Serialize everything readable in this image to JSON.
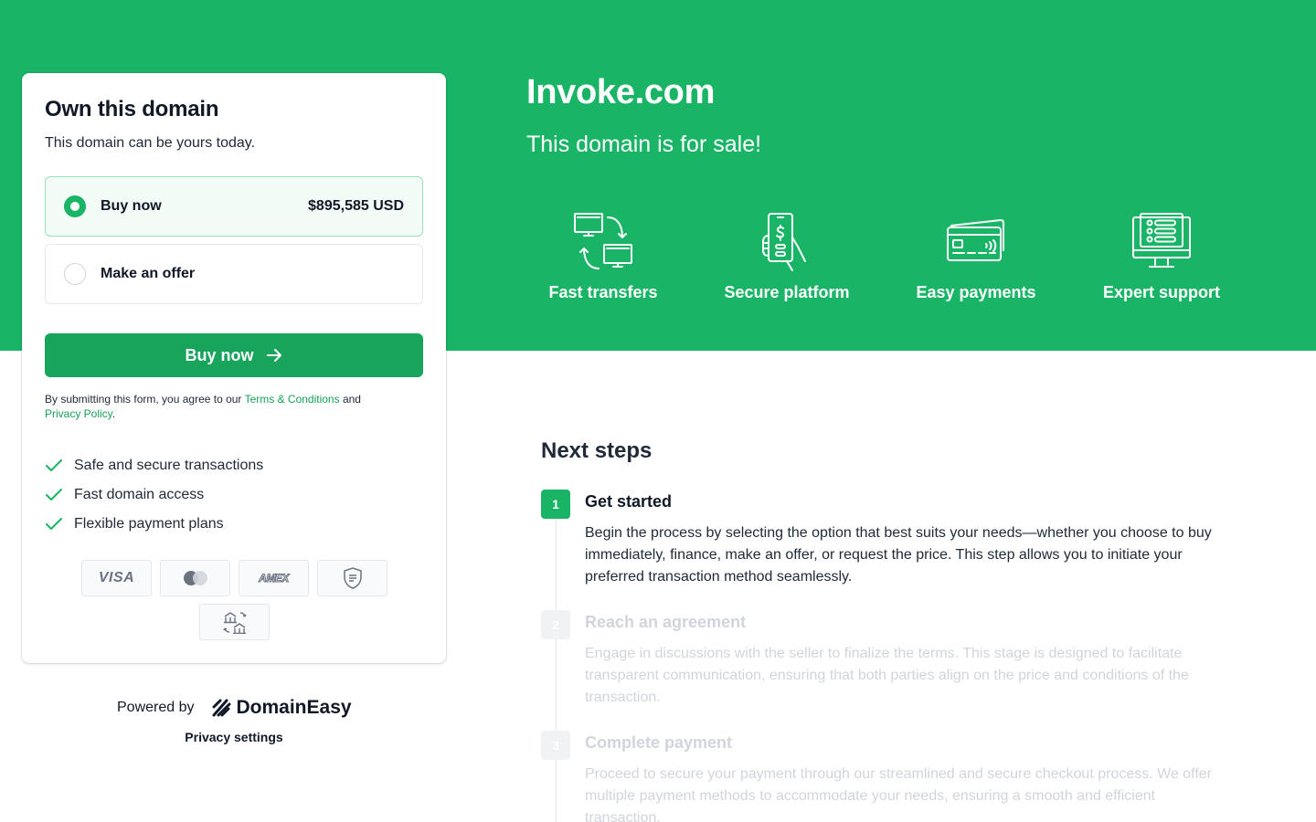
{
  "card": {
    "title": "Own this domain",
    "subtitle": "This domain can be yours today.",
    "options": [
      {
        "label": "Buy now",
        "price": "$895,585 USD",
        "selected": true
      },
      {
        "label": "Make an offer",
        "selected": false
      }
    ],
    "buy_button": "Buy now",
    "terms_prefix": "By submitting this form, you agree to our ",
    "terms_link": "Terms & Conditions",
    "terms_mid": " and",
    "privacy_link": "Privacy Policy",
    "terms_suffix": ".",
    "features": [
      "Safe and secure transactions",
      "Fast domain access",
      "Flexible payment plans"
    ],
    "payment_methods": [
      "visa",
      "mastercard",
      "amex",
      "escrow",
      "bank-transfer"
    ],
    "visa_text": "VISA",
    "amex_text": "AMEX"
  },
  "footer": {
    "powered_by": "Powered by",
    "brand": "DomainEasy",
    "privacy_settings": "Privacy settings"
  },
  "hero": {
    "domain": "Invoke.com",
    "tagline": "This domain is for sale!",
    "features": [
      {
        "label": "Fast transfers",
        "icon": "transfer-icon"
      },
      {
        "label": "Secure platform",
        "icon": "secure-phone-icon"
      },
      {
        "label": "Easy payments",
        "icon": "credit-card-icon"
      },
      {
        "label": "Expert support",
        "icon": "support-monitor-icon"
      }
    ]
  },
  "next_steps": {
    "title": "Next steps",
    "steps": [
      {
        "num": "1",
        "title": "Get started",
        "body": "Begin the process by selecting the option that best suits your needs—whether you choose to buy immediately, finance, make an offer, or request the price. This step allows you to initiate your preferred transaction method seamlessly."
      },
      {
        "num": "2",
        "title": "Reach an agreement",
        "body": "Engage in discussions with the seller to finalize the terms. This stage is designed to facilitate transparent communication, ensuring that both parties align on the price and conditions of the transaction."
      },
      {
        "num": "3",
        "title": "Complete payment",
        "body": "Proceed to secure your payment through our streamlined and secure checkout process. We offer multiple payment methods to accommodate your needs, ensuring a smooth and efficient transaction."
      }
    ]
  },
  "colors": {
    "brand_green": "#19b466",
    "button_green": "#19a45c",
    "link_green": "#16a05a"
  }
}
